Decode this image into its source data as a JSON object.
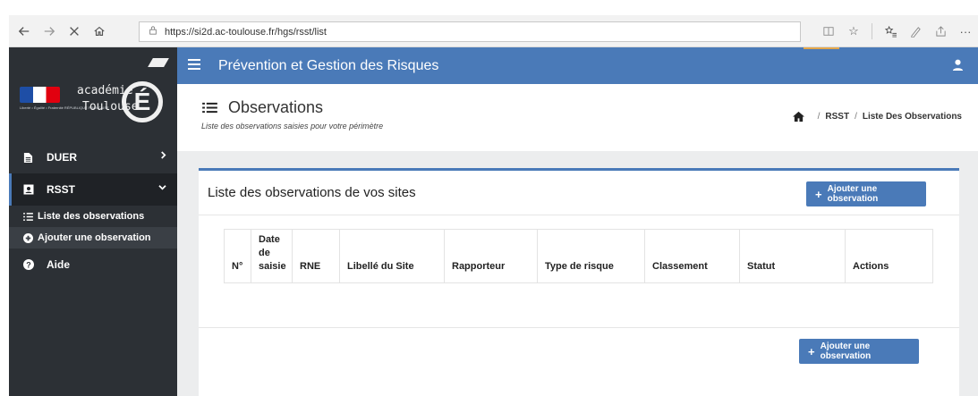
{
  "browser": {
    "url": "https://si2d.ac-toulouse.fr/hgs/rsst/list"
  },
  "sidebar": {
    "logo": {
      "line1": "académie",
      "line2": "Toulouse",
      "flag_caption": "Liberté • Égalité • Fraternité RÉPUBLIQUE FRANÇAISE",
      "letter": "É"
    },
    "items": [
      {
        "label": "DUER",
        "icon": "file-icon",
        "chevron": "›"
      },
      {
        "label": "RSST",
        "icon": "id-card-icon",
        "chevron": "⌄"
      }
    ],
    "sub_items": [
      {
        "label": "Liste des observations",
        "icon": "list-icon"
      },
      {
        "label": "Ajouter une observation",
        "icon": "plus-circle-icon"
      }
    ],
    "help": {
      "label": "Aide",
      "icon": "question-circle-icon"
    }
  },
  "header": {
    "title": "Prévention et Gestion des Risques"
  },
  "page": {
    "title": "Observations",
    "subtitle": "Liste des observations saisies pour votre périmètre",
    "breadcrumb": [
      "RSST",
      "Liste Des Observations"
    ]
  },
  "box": {
    "title": "Liste des observations de vos sites",
    "add_button": "Ajouter une observation",
    "table": {
      "columns": [
        "N°",
        "Date de saisie",
        "RNE",
        "Libellé du Site",
        "Rapporteur",
        "Type de risque",
        "Classement",
        "Statut",
        "Actions"
      ],
      "rows": []
    }
  },
  "colors": {
    "primary": "#4a7ab8",
    "sidebar": "#2c3035",
    "content_bg": "#ecedee"
  }
}
